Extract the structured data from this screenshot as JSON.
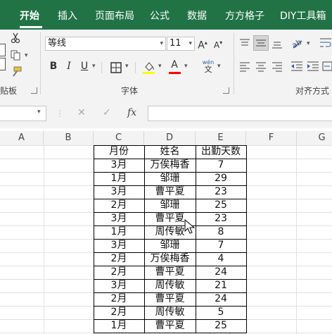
{
  "ribbon_tabs": [
    "开始",
    "插入",
    "页面布局",
    "公式",
    "数据",
    "方方格子",
    "DIY工具箱"
  ],
  "font": {
    "name": "等线",
    "size": "11",
    "grow_label": "A",
    "shrink_label": "A",
    "bold_label": "B",
    "italic_label": "I",
    "underline_label": "U",
    "font_color_label": "A",
    "phonetic_top": "wén",
    "phonetic_bottom": "文"
  },
  "group_labels": {
    "clipboard": "贴板",
    "font": "字体",
    "alignment": "对齐方式"
  },
  "formula_bar": {
    "fx_label": "fx",
    "cancel": "✕",
    "enter": "✓"
  },
  "columns": [
    "A",
    "B",
    "C",
    "D",
    "E",
    "F",
    "G"
  ],
  "table": {
    "headers": [
      "月份",
      "姓名",
      "出勤天数"
    ],
    "rows": [
      [
        "3月",
        "万俟梅香",
        "7"
      ],
      [
        "1月",
        "邹珊",
        "29"
      ],
      [
        "3月",
        "曹平夏",
        "23"
      ],
      [
        "2月",
        "邹珊",
        "25"
      ],
      [
        "3月",
        "曹平夏",
        "23"
      ],
      [
        "1月",
        "周传敏",
        "8"
      ],
      [
        "3月",
        "邹珊",
        "7"
      ],
      [
        "2月",
        "万俟梅香",
        "4"
      ],
      [
        "2月",
        "曹平夏",
        "24"
      ],
      [
        "3月",
        "周传敏",
        "21"
      ],
      [
        "2月",
        "曹平夏",
        "24"
      ],
      [
        "2月",
        "周传敏",
        "5"
      ],
      [
        "1月",
        "曹平夏",
        "25"
      ]
    ]
  },
  "colors": {
    "ribbon_green": "#217346",
    "fill_color": "#ffff00",
    "font_color": "#ff0000"
  }
}
